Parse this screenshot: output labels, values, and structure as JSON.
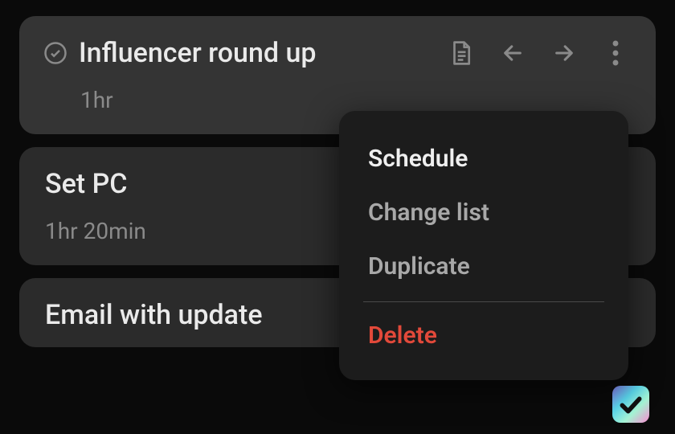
{
  "tasks": [
    {
      "title": "Influencer round up",
      "duration": "1hr",
      "selected": true,
      "has_check": true
    },
    {
      "title": "Set PC",
      "duration": "1hr 20min",
      "selected": false,
      "has_check": false
    },
    {
      "title": "Email with update",
      "duration": "",
      "selected": false,
      "has_check": false
    }
  ],
  "menu": {
    "schedule": "Schedule",
    "change_list": "Change list",
    "duplicate": "Duplicate",
    "delete": "Delete"
  }
}
